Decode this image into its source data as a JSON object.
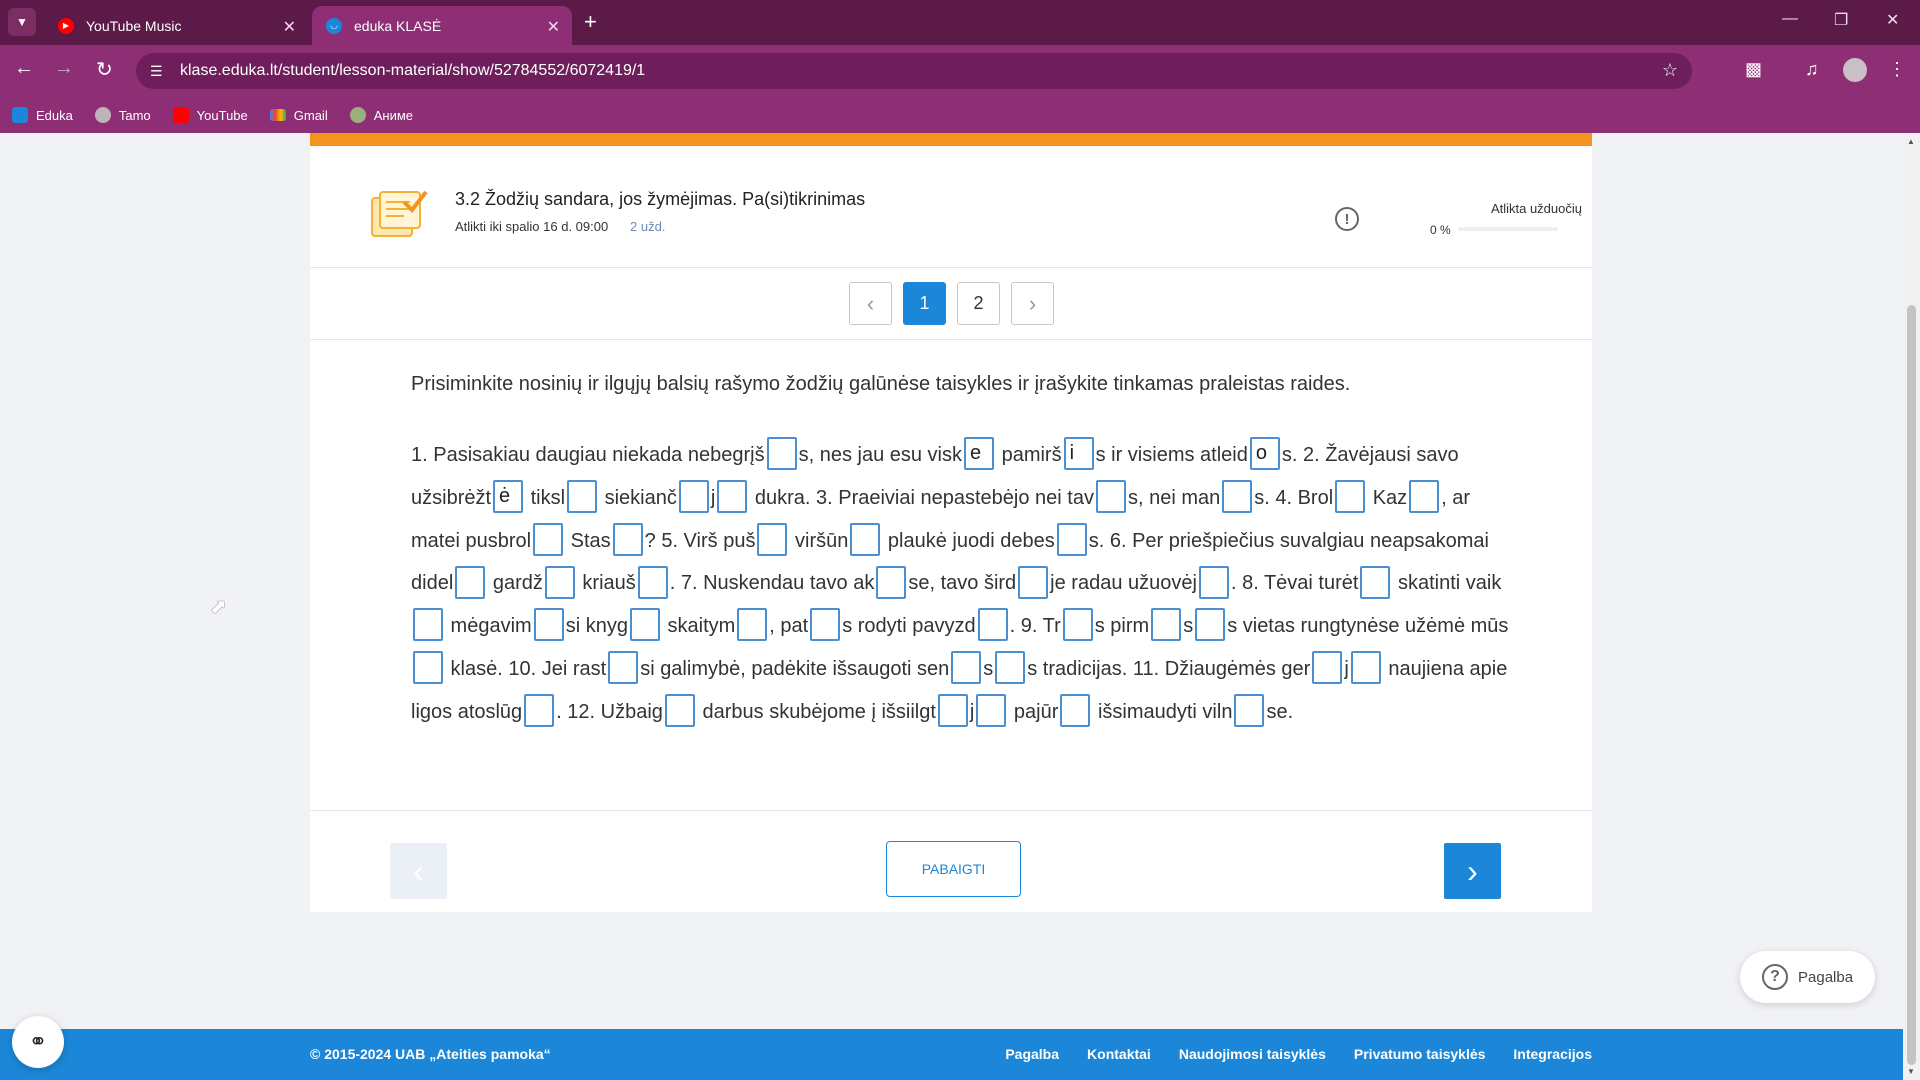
{
  "browser": {
    "tabs": [
      {
        "title": "YouTube Music"
      },
      {
        "title": "eduka KLASĖ"
      }
    ],
    "url": "klase.eduka.lt/student/lesson-material/show/52784552/6072419/1",
    "bookmarks": [
      "Eduka",
      "Tamo",
      "YouTube",
      "Gmail",
      "Аниме"
    ]
  },
  "lesson": {
    "title": "3.2 Žodžių sandara, jos žymėjimas. Pa(si)tikrinimas",
    "deadline": "Atlikti iki spalio 16 d. 09:00",
    "task_count": "2 užd.",
    "progress_label": "Atlikta užduočių",
    "progress_text": "0 %",
    "progress_value": 0
  },
  "pager": {
    "pages": [
      "1",
      "2"
    ],
    "active": "1"
  },
  "exercise": {
    "instruction": "Prisiminkite nosinių ir ilgųjų balsių rašymo žodžių galūnėse taisykles ir įrašykite tinkamas praleistas raides.",
    "segments": [
      "1. Pasisakiau daugiau niekada nebegrįš",
      "",
      "s, nes jau esu visk",
      "e",
      " pamirš",
      "i",
      "s ir visiems atleid",
      "o",
      "s. 2. Žavėjausi savo užsibrėžt",
      "ė",
      " tiksl",
      "",
      " siekianč",
      "",
      "j",
      "",
      " dukra. 3. Praeiviai nepastebėjo nei tav",
      "",
      "s, nei man",
      "",
      "s. 4. Brol",
      "",
      " Kaz",
      "",
      ", ar matei pusbrol",
      "",
      " Stas",
      "",
      "? 5. Virš puš",
      "",
      " viršūn",
      "",
      " plaukė juodi debes",
      "",
      "s. 6. Per priešpiečius suvalgiau neapsakomai didel",
      "",
      " gardž",
      "",
      " kriauš",
      "",
      ". 7. Nuskendau tavo ak",
      "",
      "se, tavo šird",
      "",
      "je radau užuovėj",
      "",
      ". 8. Tėvai turėt",
      "",
      " skatinti vaik",
      "",
      " mėgavim",
      "",
      "si knyg",
      "",
      " skaitym",
      "",
      ", pat",
      "",
      "s rodyti pavyzd",
      "",
      ". 9. Tr",
      "",
      "s pirm",
      "",
      "s",
      "",
      "s vietas rungtynėse užėmė mūs",
      "",
      " klasė. 10. Jei rast",
      "",
      "si galimybė, padėkite išsaugoti sen",
      "",
      "s",
      "",
      "s tradicijas.  11. Džiaugėmės ger",
      "",
      "j",
      "",
      " naujiena apie ligos atoslūg",
      "",
      ". 12. Užbaig",
      "",
      " darbus skubėjome į išsiilgt",
      "",
      "j",
      "",
      " pajūr",
      "",
      " išsimaudyti viln",
      "",
      "se."
    ]
  },
  "actions": {
    "finish_label": "PABAIGTI"
  },
  "help": {
    "label": "Pagalba"
  },
  "footer": {
    "copyright": "© 2015-2024 UAB „Ateities pamoka“",
    "links": [
      "Pagalba",
      "Kontaktai",
      "Naudojimosi taisyklės",
      "Privatumo taisyklės",
      "Integracijos"
    ]
  },
  "colors": {
    "brand_blue": "#1c87d8",
    "accent_orange": "#f39421",
    "browser_frame": "#8e2f76"
  }
}
